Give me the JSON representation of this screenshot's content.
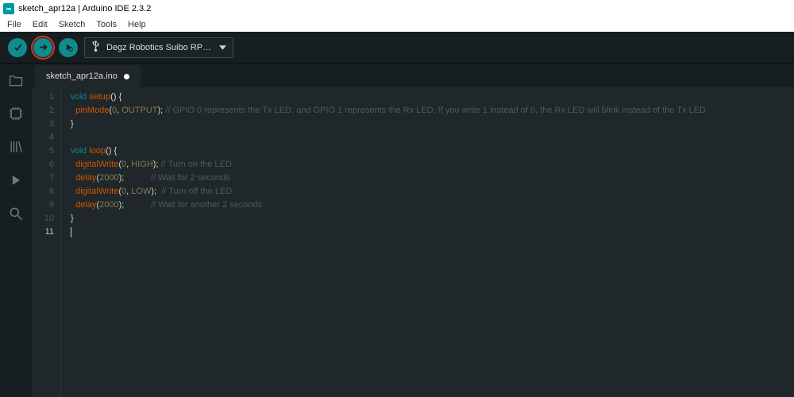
{
  "title": "sketch_apr12a | Arduino IDE 2.3.2",
  "menubar": [
    "File",
    "Edit",
    "Sketch",
    "Tools",
    "Help"
  ],
  "toolbar": {
    "board_label": "Degz Robotics Suibo RP…"
  },
  "tab": {
    "label": "sketch_apr12a.ino",
    "modified": true
  },
  "sidebar": {
    "items": [
      "folder",
      "board-manager",
      "library-manager",
      "debug",
      "search"
    ]
  },
  "code": {
    "lines": [
      {
        "n": 1,
        "tokens": [
          [
            "kw",
            "void"
          ],
          [
            "",
            " "
          ],
          [
            "fn",
            "setup"
          ],
          [
            "paren",
            "()"
          ],
          [
            "",
            " "
          ],
          [
            "brace",
            "{"
          ]
        ]
      },
      {
        "n": 2,
        "tokens": [
          [
            "",
            "  "
          ],
          [
            "fn",
            "pinMode"
          ],
          [
            "paren",
            "("
          ],
          [
            "num",
            "0"
          ],
          [
            "paren",
            ","
          ],
          [
            "",
            " "
          ],
          [
            "const",
            "OUTPUT"
          ],
          [
            "paren",
            ");"
          ],
          [
            "",
            " "
          ],
          [
            "comment",
            "// GPIO 0 represents the Tx LED, and GPIO 1 represents the Rx LED. If you write 1 instead of 0, the Rx LED will blink instead of the Tx LED."
          ]
        ]
      },
      {
        "n": 3,
        "tokens": [
          [
            "brace",
            "}"
          ]
        ]
      },
      {
        "n": 4,
        "tokens": [
          [
            "",
            ""
          ]
        ]
      },
      {
        "n": 5,
        "tokens": [
          [
            "kw",
            "void"
          ],
          [
            "",
            " "
          ],
          [
            "fn",
            "loop"
          ],
          [
            "paren",
            "()"
          ],
          [
            "",
            " "
          ],
          [
            "brace",
            "{"
          ]
        ]
      },
      {
        "n": 6,
        "tokens": [
          [
            "",
            "  "
          ],
          [
            "fn",
            "digitalWrite"
          ],
          [
            "paren",
            "("
          ],
          [
            "num",
            "0"
          ],
          [
            "paren",
            ","
          ],
          [
            "",
            " "
          ],
          [
            "const",
            "HIGH"
          ],
          [
            "paren",
            ");"
          ],
          [
            "",
            " "
          ],
          [
            "comment",
            "// Turn on the LED"
          ]
        ]
      },
      {
        "n": 7,
        "tokens": [
          [
            "",
            "  "
          ],
          [
            "fn",
            "delay"
          ],
          [
            "paren",
            "("
          ],
          [
            "num",
            "2000"
          ],
          [
            "paren",
            ");"
          ],
          [
            "",
            "           "
          ],
          [
            "comment",
            "// Wait for 2 seconds"
          ]
        ]
      },
      {
        "n": 8,
        "tokens": [
          [
            "",
            "  "
          ],
          [
            "fn",
            "digitalWrite"
          ],
          [
            "paren",
            "("
          ],
          [
            "num",
            "0"
          ],
          [
            "paren",
            ","
          ],
          [
            "",
            " "
          ],
          [
            "const",
            "LOW"
          ],
          [
            "paren",
            ");"
          ],
          [
            "",
            "  "
          ],
          [
            "comment",
            "// Turn off the LED"
          ]
        ]
      },
      {
        "n": 9,
        "tokens": [
          [
            "",
            "  "
          ],
          [
            "fn",
            "delay"
          ],
          [
            "paren",
            "("
          ],
          [
            "num",
            "2000"
          ],
          [
            "paren",
            ");"
          ],
          [
            "",
            "           "
          ],
          [
            "comment",
            "// Wait for another 2 seconds"
          ]
        ]
      },
      {
        "n": 10,
        "tokens": [
          [
            "brace",
            "}"
          ]
        ]
      },
      {
        "n": 11,
        "tokens": [
          [
            "",
            ""
          ]
        ],
        "active": true
      }
    ]
  }
}
